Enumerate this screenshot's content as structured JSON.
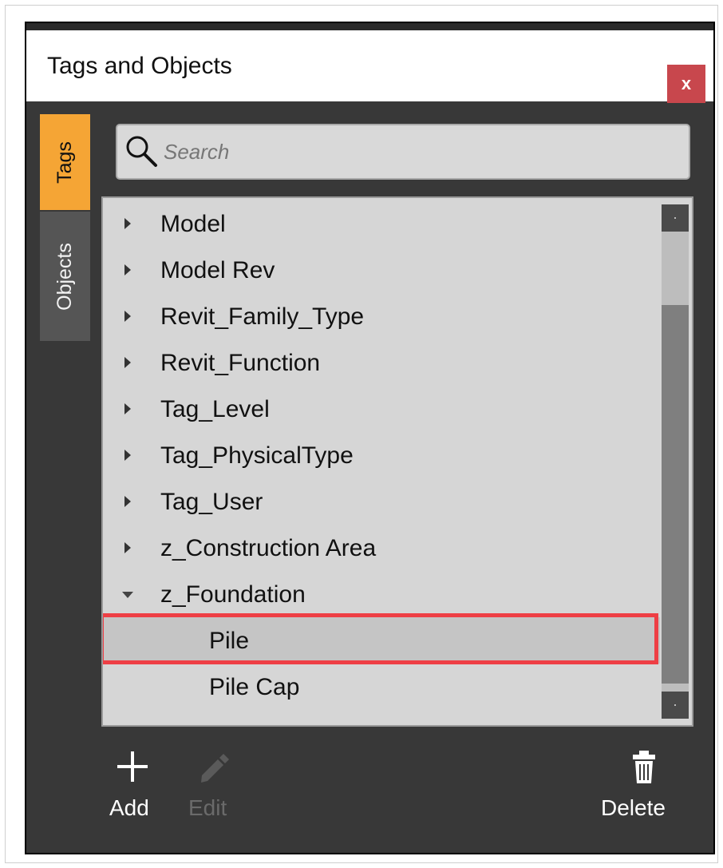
{
  "window": {
    "title": "Tags and Objects",
    "close_label": "x"
  },
  "side_tabs": [
    {
      "label": "Tags",
      "active": true
    },
    {
      "label": "Objects",
      "active": false
    }
  ],
  "search": {
    "placeholder": "Search",
    "icon": "search-icon"
  },
  "tree": {
    "items": [
      {
        "label": "Model",
        "expanded": false
      },
      {
        "label": "Model Rev",
        "expanded": false
      },
      {
        "label": "Revit_Family_Type",
        "expanded": false
      },
      {
        "label": "Revit_Function",
        "expanded": false
      },
      {
        "label": "Tag_Level",
        "expanded": false
      },
      {
        "label": "Tag_PhysicalType",
        "expanded": false
      },
      {
        "label": "Tag_User",
        "expanded": false
      },
      {
        "label": "z_Construction Area",
        "expanded": false
      },
      {
        "label": "z_Foundation",
        "expanded": true,
        "children": [
          {
            "label": "Pile",
            "selected": true
          },
          {
            "label": "Pile Cap",
            "selected": false
          }
        ]
      }
    ]
  },
  "toolbar": {
    "add_label": "Add",
    "edit_label": "Edit",
    "delete_label": "Delete",
    "add_icon": "plus-icon",
    "edit_icon": "pencil-icon",
    "delete_icon": "trash-icon",
    "edit_enabled": false
  },
  "colors": {
    "active_tab": "#f5a535",
    "inactive_tab": "#555555",
    "panel_background": "#383838",
    "tree_background": "#d6d6d6",
    "close_button": "#c8474d",
    "highlight": "#ee3f45"
  }
}
